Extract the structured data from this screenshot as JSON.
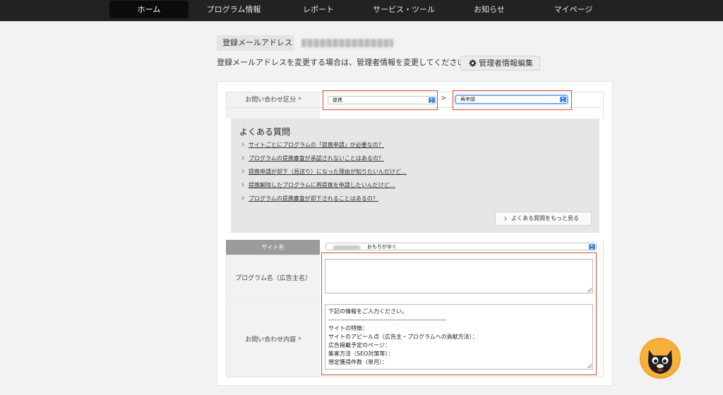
{
  "nav": {
    "items": [
      "ホーム",
      "プログラム情報",
      "レポート",
      "サービス・ツール",
      "お知らせ",
      "マイページ"
    ]
  },
  "account": {
    "email_label": "登録メールアドレス",
    "notice": "登録メールアドレスを変更する場合は、管理者情報を変更してください。",
    "admin_button": "管理者情報編集"
  },
  "inquiry": {
    "category_label": "お問い合わせ区分",
    "required_mark": "*",
    "category_value": "提携",
    "separator": ">",
    "subcategory_value": "再申請"
  },
  "faq": {
    "title": "よくある質問",
    "items": [
      "サイトごとにプログラムの「提携申請」が必要なの？",
      "プログラムの提携審査が承認されないことはあるの？",
      "提携申請が却下（見送り）になった理由が知りたいんだけど…",
      "提携解除したプログラムに再提携を申請したいんだけど…",
      "プログラムの提携審査が却下されることはあるの？"
    ],
    "more_button": "よくある質問をもっと見る"
  },
  "form": {
    "site_label": "サイト名",
    "site_value": "おもちがゆく",
    "program_label": "プログラム名（広告主名）",
    "content_label": "お問い合わせ内容",
    "content_lines": [
      "下記の情報をご入力ください。",
      "----------------------------------------------------------",
      "サイトの特徴：",
      "サイトのアピール点（広告主・プログラムへの貢献方法）：",
      "広告掲載予定のページ：",
      "集客方法（SEO対策等）：",
      "想定獲得件数（単月）："
    ]
  },
  "colors": {
    "nav_bg": "#222222",
    "highlight_red": "#d94736",
    "select_blue": "#3b84ea",
    "required_red": "#e03c3c"
  },
  "icons": [
    "gear-icon",
    "chevron-right-icon",
    "select-arrows-icon",
    "resize-grip-icon",
    "cat-mascot-icon"
  ]
}
